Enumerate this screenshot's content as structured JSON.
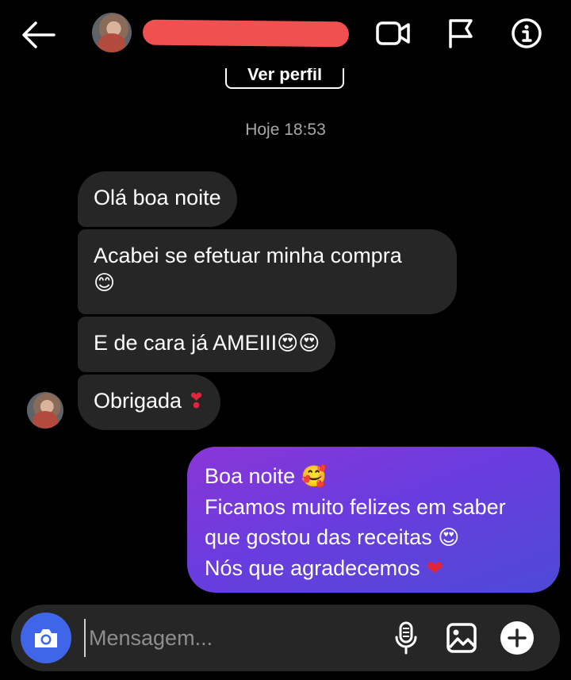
{
  "header": {
    "back_icon": "arrow-left-icon",
    "contact_name_redacted": true,
    "video_icon": "video-call-icon",
    "flag_icon": "flag-icon",
    "info_icon": "info-icon",
    "view_profile_label": "Ver perfil"
  },
  "timestamp": "Hoje 18:53",
  "messages": {
    "incoming": [
      {
        "text": "Olá boa noite",
        "emoji": ""
      },
      {
        "text": "Acabei se efetuar minha compra",
        "emoji": "😊"
      },
      {
        "text": "E de cara já AMEIII",
        "emoji": "😍😍"
      },
      {
        "text": "Obrigada",
        "emoji": "❣"
      }
    ],
    "outgoing": {
      "lines": [
        {
          "text": "Boa noite",
          "emoji": "🥰"
        },
        {
          "text": "Ficamos muito felizes em saber",
          "emoji": ""
        },
        {
          "text": "que gostou das receitas",
          "emoji": "😍"
        },
        {
          "text": "Nós que agradecemos",
          "emoji": "❤"
        }
      ]
    }
  },
  "composer": {
    "camera_icon": "camera-icon",
    "placeholder": "Mensagem...",
    "mic_icon": "microphone-icon",
    "gallery_icon": "image-gallery-icon",
    "plus_icon": "plus-circle-icon"
  },
  "colors": {
    "background": "#000000",
    "incoming_bubble": "#262626",
    "outgoing_gradient_start": "#8a36d6",
    "outgoing_gradient_end": "#4e4ad6",
    "camera_button": "#3f66e8",
    "timestamp_text": "#a8a8a8"
  }
}
